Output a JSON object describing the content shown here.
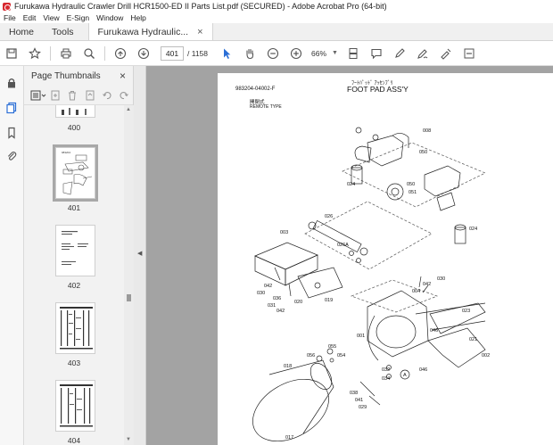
{
  "window": {
    "title": "Furukawa Hydraulic Crawler Drill HCR1500-ED II Parts List.pdf (SECURED) - Adobe Acrobat Pro (64-bit)"
  },
  "menu": [
    "File",
    "Edit",
    "View",
    "E-Sign",
    "Window",
    "Help"
  ],
  "tabs": [
    {
      "label": "Home"
    },
    {
      "label": "Tools"
    },
    {
      "label": "Furukawa Hydraulic...",
      "close": "×"
    }
  ],
  "toolbar": {
    "current_page": "401",
    "total_pages": "/ 1158",
    "zoom": "66%"
  },
  "thumbnails_panel": {
    "title": "Page Thumbnails",
    "close": "×",
    "pages": [
      "400",
      "401",
      "402",
      "403",
      "404"
    ],
    "selected": "401"
  },
  "document": {
    "code": "983204-04002-F",
    "title_jp": "ﾌｰﾄﾊﾟｯﾄﾞ ｱｯｾﾝﾌﾞﾘ",
    "title": "FOOT PAD ASS'Y",
    "subtitle_jp": "開閉式",
    "subtitle": "REMOTE TYPE",
    "callouts": [
      "008",
      "050",
      "024",
      "050",
      "051",
      "024",
      "026",
      "003",
      "026A",
      "030",
      "042",
      "036",
      "031",
      "042",
      "020",
      "019",
      "004",
      "042",
      "030",
      "023",
      "001",
      "046",
      "021",
      "002",
      "056",
      "055",
      "054",
      "018",
      "032",
      "034",
      "046",
      "038",
      "041",
      "029",
      "017",
      "A"
    ]
  }
}
